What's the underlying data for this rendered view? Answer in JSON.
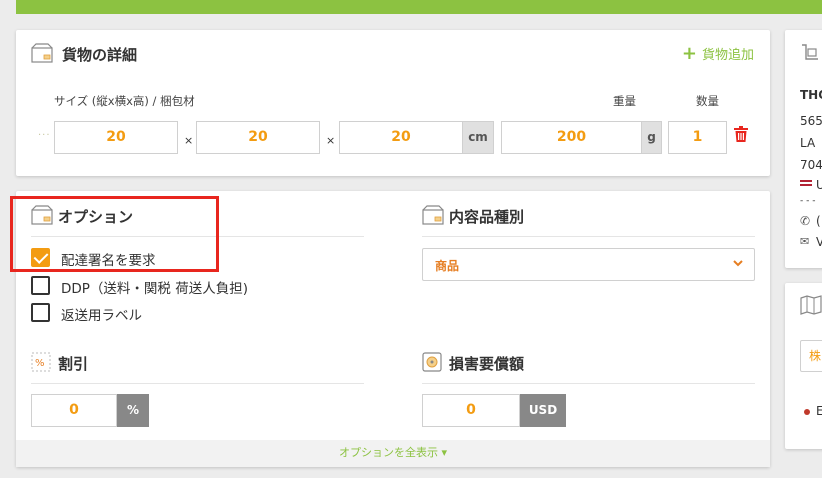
{
  "cargo": {
    "title": "貨物の詳細",
    "add_label": "貨物追加",
    "size_label": "サイズ (縦x横x高) / 梱包材",
    "weight_label": "重量",
    "qty_label": "数量",
    "length": "20",
    "width": "20",
    "height": "20",
    "dim_unit": "cm",
    "weight": "200",
    "weight_unit": "g",
    "quantity": "1",
    "times": "×"
  },
  "options": {
    "title": "オプション",
    "items": [
      {
        "label": "配達署名を要求",
        "checked": true
      },
      {
        "label": "DDP（送料・関税 荷送人負担)",
        "checked": false
      },
      {
        "label": "返送用ラベル",
        "checked": false
      }
    ],
    "show_all": "オプションを全表示 ▾"
  },
  "contents": {
    "title": "内容品種別",
    "selected": "商品"
  },
  "discount": {
    "title": "割引",
    "value": "0",
    "unit": "%"
  },
  "insurance": {
    "title": "損害要償額",
    "value": "0",
    "unit": "USD"
  },
  "address": {
    "name": "THO",
    "line1": "565",
    "line2": "LA",
    "line3": "704",
    "country": "U",
    "sep": "- - -",
    "phone": "(",
    "email": "V"
  },
  "map": {
    "select_value": "株",
    "dot_label": "E"
  },
  "colors": {
    "accent": "#8cc241",
    "orange": "#f39c12",
    "highlight": "#e8261e"
  }
}
